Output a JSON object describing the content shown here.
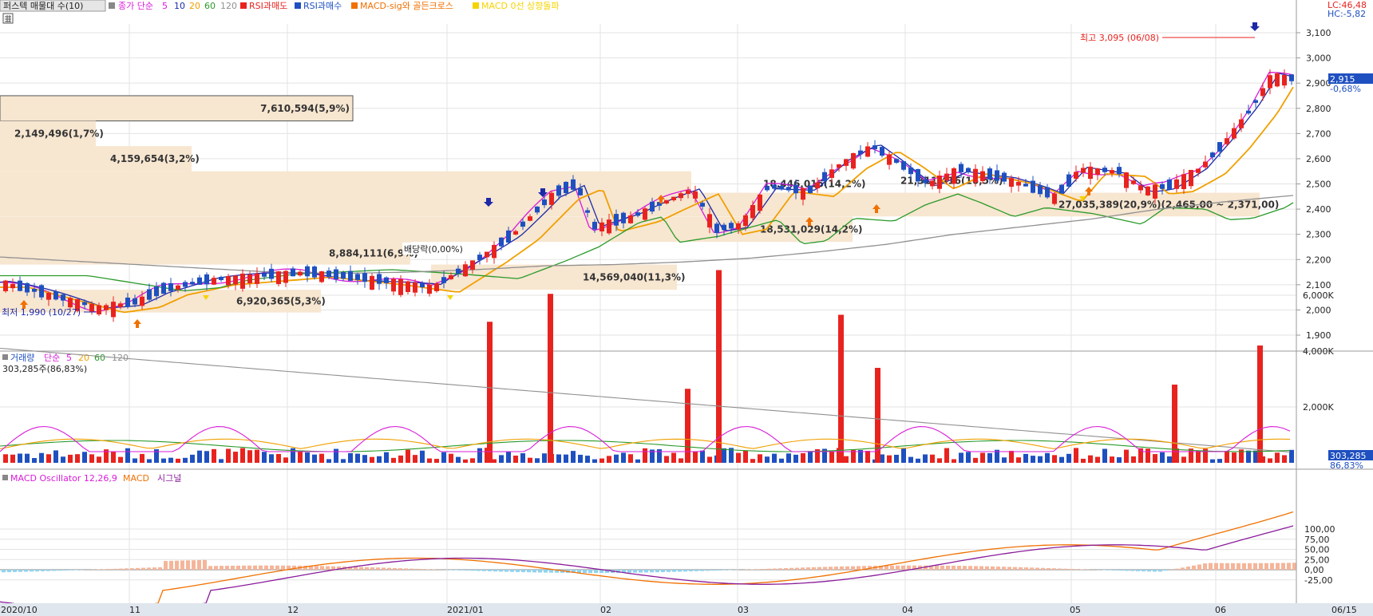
{
  "header": {
    "title": "퍼스텍 매물대 수(10)",
    "ma_label": "종가 단순",
    "ma_periods": [
      "5",
      "10",
      "20",
      "60",
      "120"
    ],
    "rsi_sell": "RSI과매도",
    "rsi_buy": "RSI과매수",
    "macd_cross": "MACD-sig와 골든크로스",
    "macd_zero": "MACD 0선 상향돌파",
    "lc": "LC:46,48",
    "hc": "HC:-5,82"
  },
  "volume_header": {
    "title": "거래량",
    "ma_label": "단순",
    "ma_periods": [
      "5",
      "20",
      "60",
      "120"
    ],
    "current": "303,285주(86,83%)",
    "tag_value": "303,285",
    "tag_pct": "86,83%"
  },
  "macd_header": {
    "title": "MACD Oscillator 12,26,9",
    "macd": "MACD",
    "signal": "시그널"
  },
  "price_tag": {
    "value": "2,915",
    "pct": "-0,68%"
  },
  "x_labels": [
    "2020/10",
    "11",
    "12",
    "2021/01",
    "02",
    "03",
    "04",
    "05",
    "06",
    "06/15"
  ],
  "colors": {
    "up": "#e8231f",
    "down": "#1f50c0",
    "ma5": "#d81cd8",
    "ma10": "#1c2aa8",
    "ma20": "#f0a000",
    "ma60": "#2a9a2a",
    "ma120": "#909090",
    "profile": "#f7e6d0",
    "osc_pos": "#f5b59a",
    "osc_neg": "#8fd3ef"
  },
  "chart_data": [
    {
      "type": "candlestick",
      "panel": "price",
      "ylim": [
        1820,
        3170
      ],
      "y_ticks": [
        "3,100",
        "3,000",
        "2,900",
        "2,800",
        "2,700",
        "2,600",
        "2,500",
        "2,400",
        "2,300",
        "2,200",
        "2,100",
        "2,000",
        "1,900"
      ],
      "high": {
        "label": "최고 3,095 (06/08)",
        "value": 3095
      },
      "low": {
        "label": "최저 1,990 (10/27)",
        "value": 1990
      },
      "annotation": "배당락(0,00%)",
      "last_close": 2915,
      "volume_profile": [
        {
          "label": "7,610,594(5,9%)",
          "low": 2750,
          "high": 2850
        },
        {
          "label": "2,149,496(1,7%)",
          "low": 2650,
          "high": 2750
        },
        {
          "label": "4,159,654(3,2%)",
          "low": 2550,
          "high": 2650
        },
        {
          "label": "18,446,015(14,2%)",
          "low": 2450,
          "high": 2550
        },
        {
          "label": "27,035,389(20,9%)(2,465,00 ~ 2,371,00)",
          "low": 2371,
          "high": 2465
        },
        {
          "label": "21,311,416(16,5%)",
          "low": 2465,
          "high": 2560
        },
        {
          "label": "18,531,029(14,2%)",
          "low": 2270,
          "high": 2370
        },
        {
          "label": "8,884,111(6,9%)",
          "low": 2180,
          "high": 2270
        },
        {
          "label": "14,569,040(11,3%)",
          "low": 2080,
          "high": 2180
        },
        {
          "label": "6,920,365(5,3%)",
          "low": 1990,
          "high": 2080
        }
      ],
      "ma120": [
        2210,
        2195,
        2180,
        2165,
        2150,
        2145,
        2150,
        2160,
        2175,
        2180,
        2190,
        2205,
        2230,
        2260,
        2300,
        2330,
        2360,
        2400,
        2430,
        2455
      ]
    },
    {
      "type": "bar",
      "panel": "volume",
      "ylim": [
        0,
        7200000
      ],
      "y_ticks": [
        "6,000K",
        "4,000K",
        "2,000K"
      ],
      "spikes": [
        {
          "month": "2021/01",
          "value": 5050000
        },
        {
          "month": "2021/01",
          "value": 6050000
        },
        {
          "month": "02",
          "value": 2650000
        },
        {
          "month": "02",
          "value": 6900000
        },
        {
          "month": "03",
          "value": 5300000
        },
        {
          "month": "03",
          "value": 3400000
        },
        {
          "month": "05",
          "value": 2800000
        },
        {
          "month": "06",
          "value": 4200000
        }
      ],
      "last_value": 303285
    },
    {
      "type": "line",
      "panel": "macd",
      "ylim": [
        -40,
        115
      ],
      "y_ticks": [
        "100,00",
        "75,00",
        "50,00",
        "25,00",
        "0,00",
        "-25,00"
      ],
      "series": [
        {
          "name": "MACD"
        },
        {
          "name": "시그널"
        },
        {
          "name": "MACD Oscillator 12,26,9"
        }
      ]
    }
  ]
}
